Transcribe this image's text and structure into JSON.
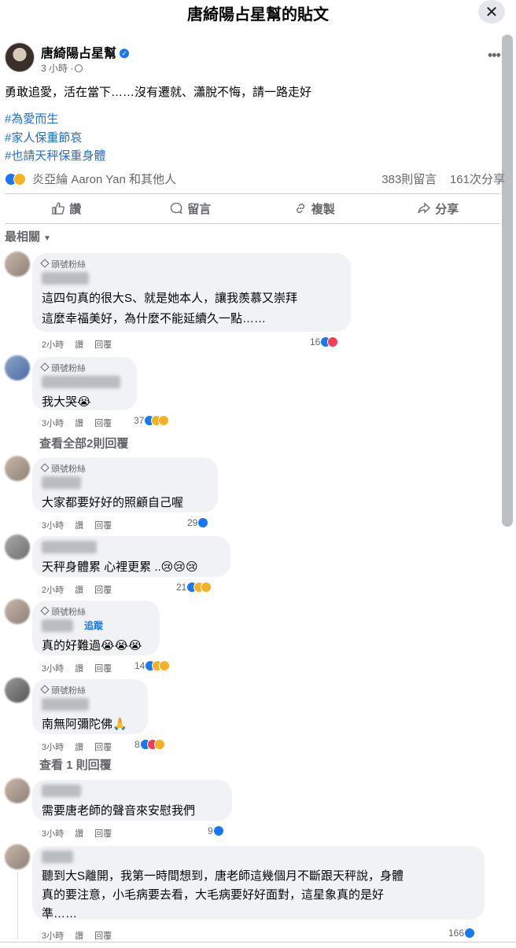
{
  "dialog": {
    "title": "唐綺陽占星幫的貼文",
    "close": "✕"
  },
  "post": {
    "page_name": "唐綺陽占星幫",
    "verified": "✓",
    "time": "3 小時 ·",
    "more": "•••",
    "text": "勇敢追愛，活在當下……沒有遷就、瀟脫不悔，請一路走好",
    "hashtags": [
      "#為愛而生",
      "#家人保重節哀",
      "#也請天秤保重身體"
    ],
    "reactors": "炎亞綸 Aaron Yan 和其他人",
    "comments_count": "383則留言",
    "shares_count": "161次分享"
  },
  "actions": {
    "like": "讚",
    "comment": "留言",
    "copy": "複製",
    "share": "分享"
  },
  "sort": {
    "label": "最相關",
    "caret": "▼"
  },
  "badge_text": "頭號粉絲",
  "meta_like": "讚",
  "meta_reply": "回覆",
  "comments": [
    {
      "time": "2小時",
      "lines": [
        "這四句真的很大S、就是她本人，讓我羨慕又崇拜",
        "這麼幸福美好，為什麼不能延續久一點……"
      ],
      "count": "16",
      "reactions": [
        "like",
        "love"
      ]
    },
    {
      "time": "3小時",
      "lines": [
        "我大哭😭"
      ],
      "count": "37",
      "reactions": [
        "like",
        "sad",
        "care"
      ]
    },
    {
      "time": "3小時",
      "lines": [
        "大家都要好好的照顧自己喔"
      ],
      "count": "29",
      "reactions": [
        "like"
      ]
    },
    {
      "time": "2小時",
      "lines": [
        "天秤身體累 心裡更累 ..😢😢😢"
      ],
      "count": "21",
      "reactions": [
        "like",
        "sad",
        "care"
      ]
    },
    {
      "time": "3小時",
      "lines": [
        "真的好難過😭😭😭"
      ],
      "count": "14",
      "reactions": [
        "like",
        "care",
        "sad"
      ],
      "follow": "追蹤"
    },
    {
      "time": "3小時",
      "lines": [
        "南無阿彌陀佛🙏"
      ],
      "count": "8",
      "reactions": [
        "like",
        "love",
        "care"
      ]
    },
    {
      "time": "3小時",
      "lines": [
        "需要唐老師的聲音來安慰我們"
      ],
      "count": "9",
      "reactions": [
        "like"
      ]
    },
    {
      "time": "3小時",
      "lines": [
        "聽到大S離開，我第一時間想到，唐老師這幾個月不斷跟天秤說，身體",
        "真的要注意，小毛病要去看，大毛病要好好面對，這星象真的是好",
        "準……"
      ],
      "count": "166",
      "reactions": [
        "like"
      ]
    }
  ],
  "view_replies": [
    "查看全部2則回覆",
    "查看 1 則回覆"
  ]
}
